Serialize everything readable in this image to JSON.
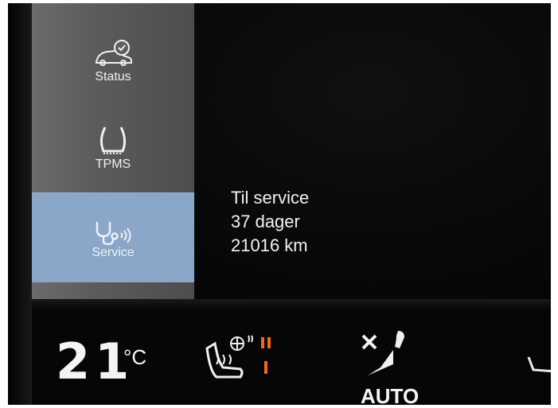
{
  "sidebar": {
    "items": [
      {
        "label": "Status",
        "icon": "car-check-icon"
      },
      {
        "label": "TPMS",
        "icon": "tire-icon"
      },
      {
        "label": "Service",
        "icon": "stethoscope-icon"
      }
    ],
    "selected": "Service",
    "selected_color": "#8aa7c9"
  },
  "service_info": {
    "line1": "Til service",
    "line2": "37 dager",
    "line3": "21016 km"
  },
  "climate": {
    "temperature": "21",
    "unit": "°C",
    "seat_heat_icon": "heated-seat-icon",
    "fan_mode": "AUTO"
  }
}
